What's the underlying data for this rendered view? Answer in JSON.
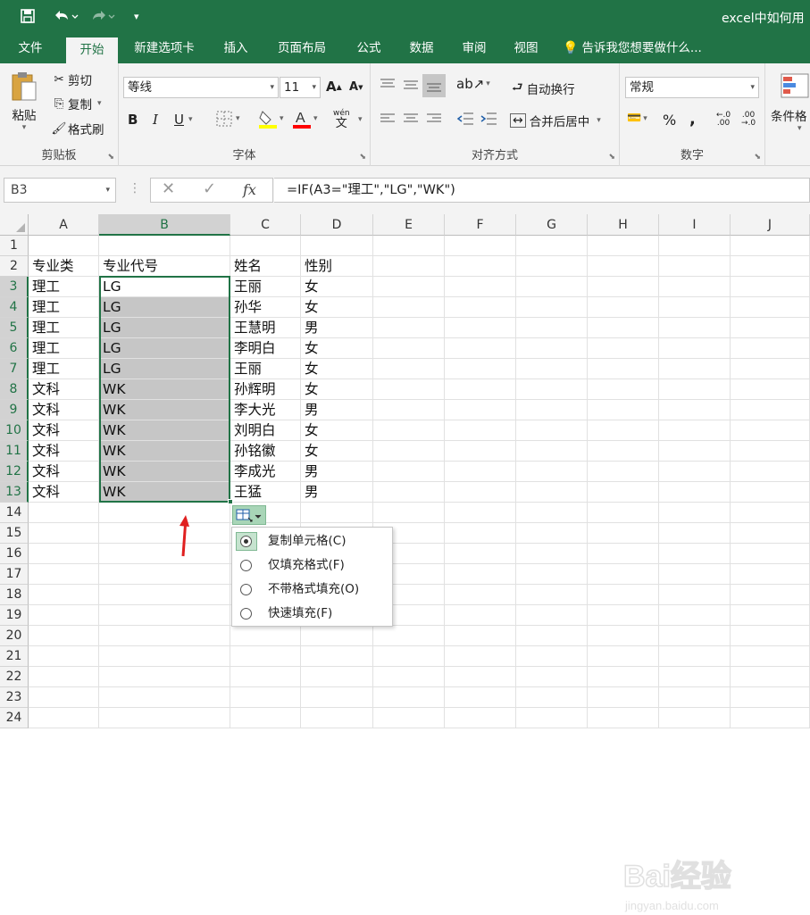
{
  "window": {
    "title": "excel中如何用"
  },
  "qat": {
    "save_icon": "save-icon",
    "undo_icon": "undo-icon",
    "redo_icon": "redo-icon"
  },
  "tabs": [
    "文件",
    "开始",
    "新建选项卡",
    "插入",
    "页面布局",
    "公式",
    "数据",
    "审阅",
    "视图"
  ],
  "tell_me": "告诉我您想要做什么...",
  "ribbon": {
    "clipboard": {
      "paste": "粘贴",
      "cut": "剪切",
      "copy": "复制",
      "format_painter": "格式刷",
      "label": "剪贴板"
    },
    "font": {
      "font_name": "等线",
      "font_size": "11",
      "label": "字体",
      "bold": "B",
      "italic": "I",
      "underline": "U",
      "grow": "A",
      "shrink": "A",
      "phonetic": "wén"
    },
    "alignment": {
      "wrap_text": "自动换行",
      "merge_center": "合并后居中",
      "label": "对齐方式"
    },
    "number": {
      "format": "常规",
      "percent": "%",
      "comma": ",",
      "label": "数字"
    },
    "styles": {
      "conditional": "条件格"
    }
  },
  "formula_bar": {
    "name_box": "B3",
    "formula": "=IF(A3=\"理工\",\"LG\",\"WK\")",
    "fx": "fx"
  },
  "grid": {
    "columns": [
      "A",
      "B",
      "C",
      "D",
      "E",
      "F",
      "G",
      "H",
      "I",
      "J"
    ],
    "row_numbers": [
      "1",
      "2",
      "3",
      "4",
      "5",
      "6",
      "7",
      "8",
      "9",
      "10",
      "11",
      "12",
      "13",
      "14",
      "15",
      "16",
      "17",
      "18",
      "19",
      "20",
      "21",
      "22",
      "23",
      "24"
    ],
    "header_row": {
      "a": "专业类",
      "b": "专业代号",
      "c": "姓名",
      "d": "性别"
    },
    "rows": [
      {
        "a": "理工",
        "b": "LG",
        "c": "王丽",
        "d": "女"
      },
      {
        "a": "理工",
        "b": "LG",
        "c": "孙华",
        "d": "女"
      },
      {
        "a": "理工",
        "b": "LG",
        "c": "王慧明",
        "d": "男"
      },
      {
        "a": "理工",
        "b": "LG",
        "c": "李明白",
        "d": "女"
      },
      {
        "a": "理工",
        "b": "LG",
        "c": "王丽",
        "d": "女"
      },
      {
        "a": "文科",
        "b": "WK",
        "c": "孙辉明",
        "d": "女"
      },
      {
        "a": "文科",
        "b": "WK",
        "c": "李大光",
        "d": "男"
      },
      {
        "a": "文科",
        "b": "WK",
        "c": "刘明白",
        "d": "女"
      },
      {
        "a": "文科",
        "b": "WK",
        "c": "孙铭徽",
        "d": "女"
      },
      {
        "a": "文科",
        "b": "WK",
        "c": "李成光",
        "d": "男"
      },
      {
        "a": "文科",
        "b": "WK",
        "c": "王猛",
        "d": "男"
      }
    ]
  },
  "autofill_menu": {
    "selected": "复制单元格(C)",
    "items": [
      "复制单元格(C)",
      "仅填充格式(F)",
      "不带格式填充(O)",
      "快速填充(F)"
    ]
  },
  "watermark": {
    "brand": "Bai经验",
    "url": "jingyan.baidu.com"
  },
  "colors": {
    "excel_green": "#217346",
    "selection_gray": "#c6c6c6",
    "arrow_red": "#e02020"
  }
}
